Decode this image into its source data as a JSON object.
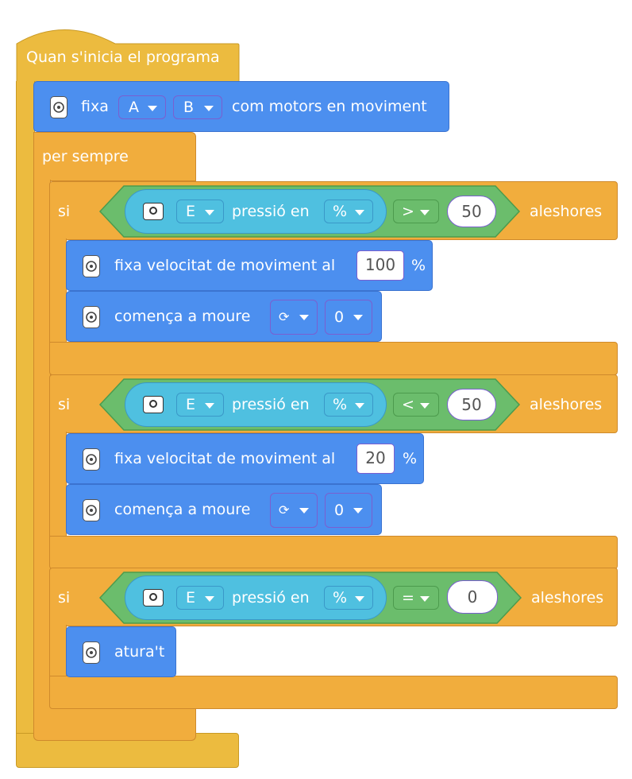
{
  "hat": {
    "label": "Quan s'inicia el programa"
  },
  "set_motors": {
    "prefix": "fixa",
    "motor_a": "A",
    "motor_b": "B",
    "suffix": "com motors en moviment"
  },
  "forever": {
    "label": "per sempre"
  },
  "if_blocks": [
    {
      "if_label": "si",
      "sensor_port": "E",
      "sensor_text": "pressió en",
      "unit": "%",
      "operator": ">",
      "value": "50",
      "then_label": "aleshores",
      "body": [
        {
          "text": "fixa velocitat de moviment al",
          "value": "100",
          "unit": "%"
        },
        {
          "text": "comença a moure",
          "direction": "⟳",
          "value": "0"
        }
      ]
    },
    {
      "if_label": "si",
      "sensor_port": "E",
      "sensor_text": "pressió en",
      "unit": "%",
      "operator": "<",
      "value": "50",
      "then_label": "aleshores",
      "body": [
        {
          "text": "fixa velocitat de moviment al",
          "value": "20",
          "unit": "%"
        },
        {
          "text": "comença a moure",
          "direction": "⟳",
          "value": "0"
        }
      ]
    },
    {
      "if_label": "si",
      "sensor_port": "E",
      "sensor_text": "pressió en",
      "unit": "%",
      "operator": "=",
      "value": "0",
      "then_label": "aleshores",
      "body": [
        {
          "text": "atura't"
        }
      ]
    }
  ],
  "colors": {
    "hat": "#ecbb3f",
    "control": "#f1ad3d",
    "motion": "#4c8fef",
    "operator": "#6bbd6c",
    "sensor": "#4fc0e0"
  }
}
